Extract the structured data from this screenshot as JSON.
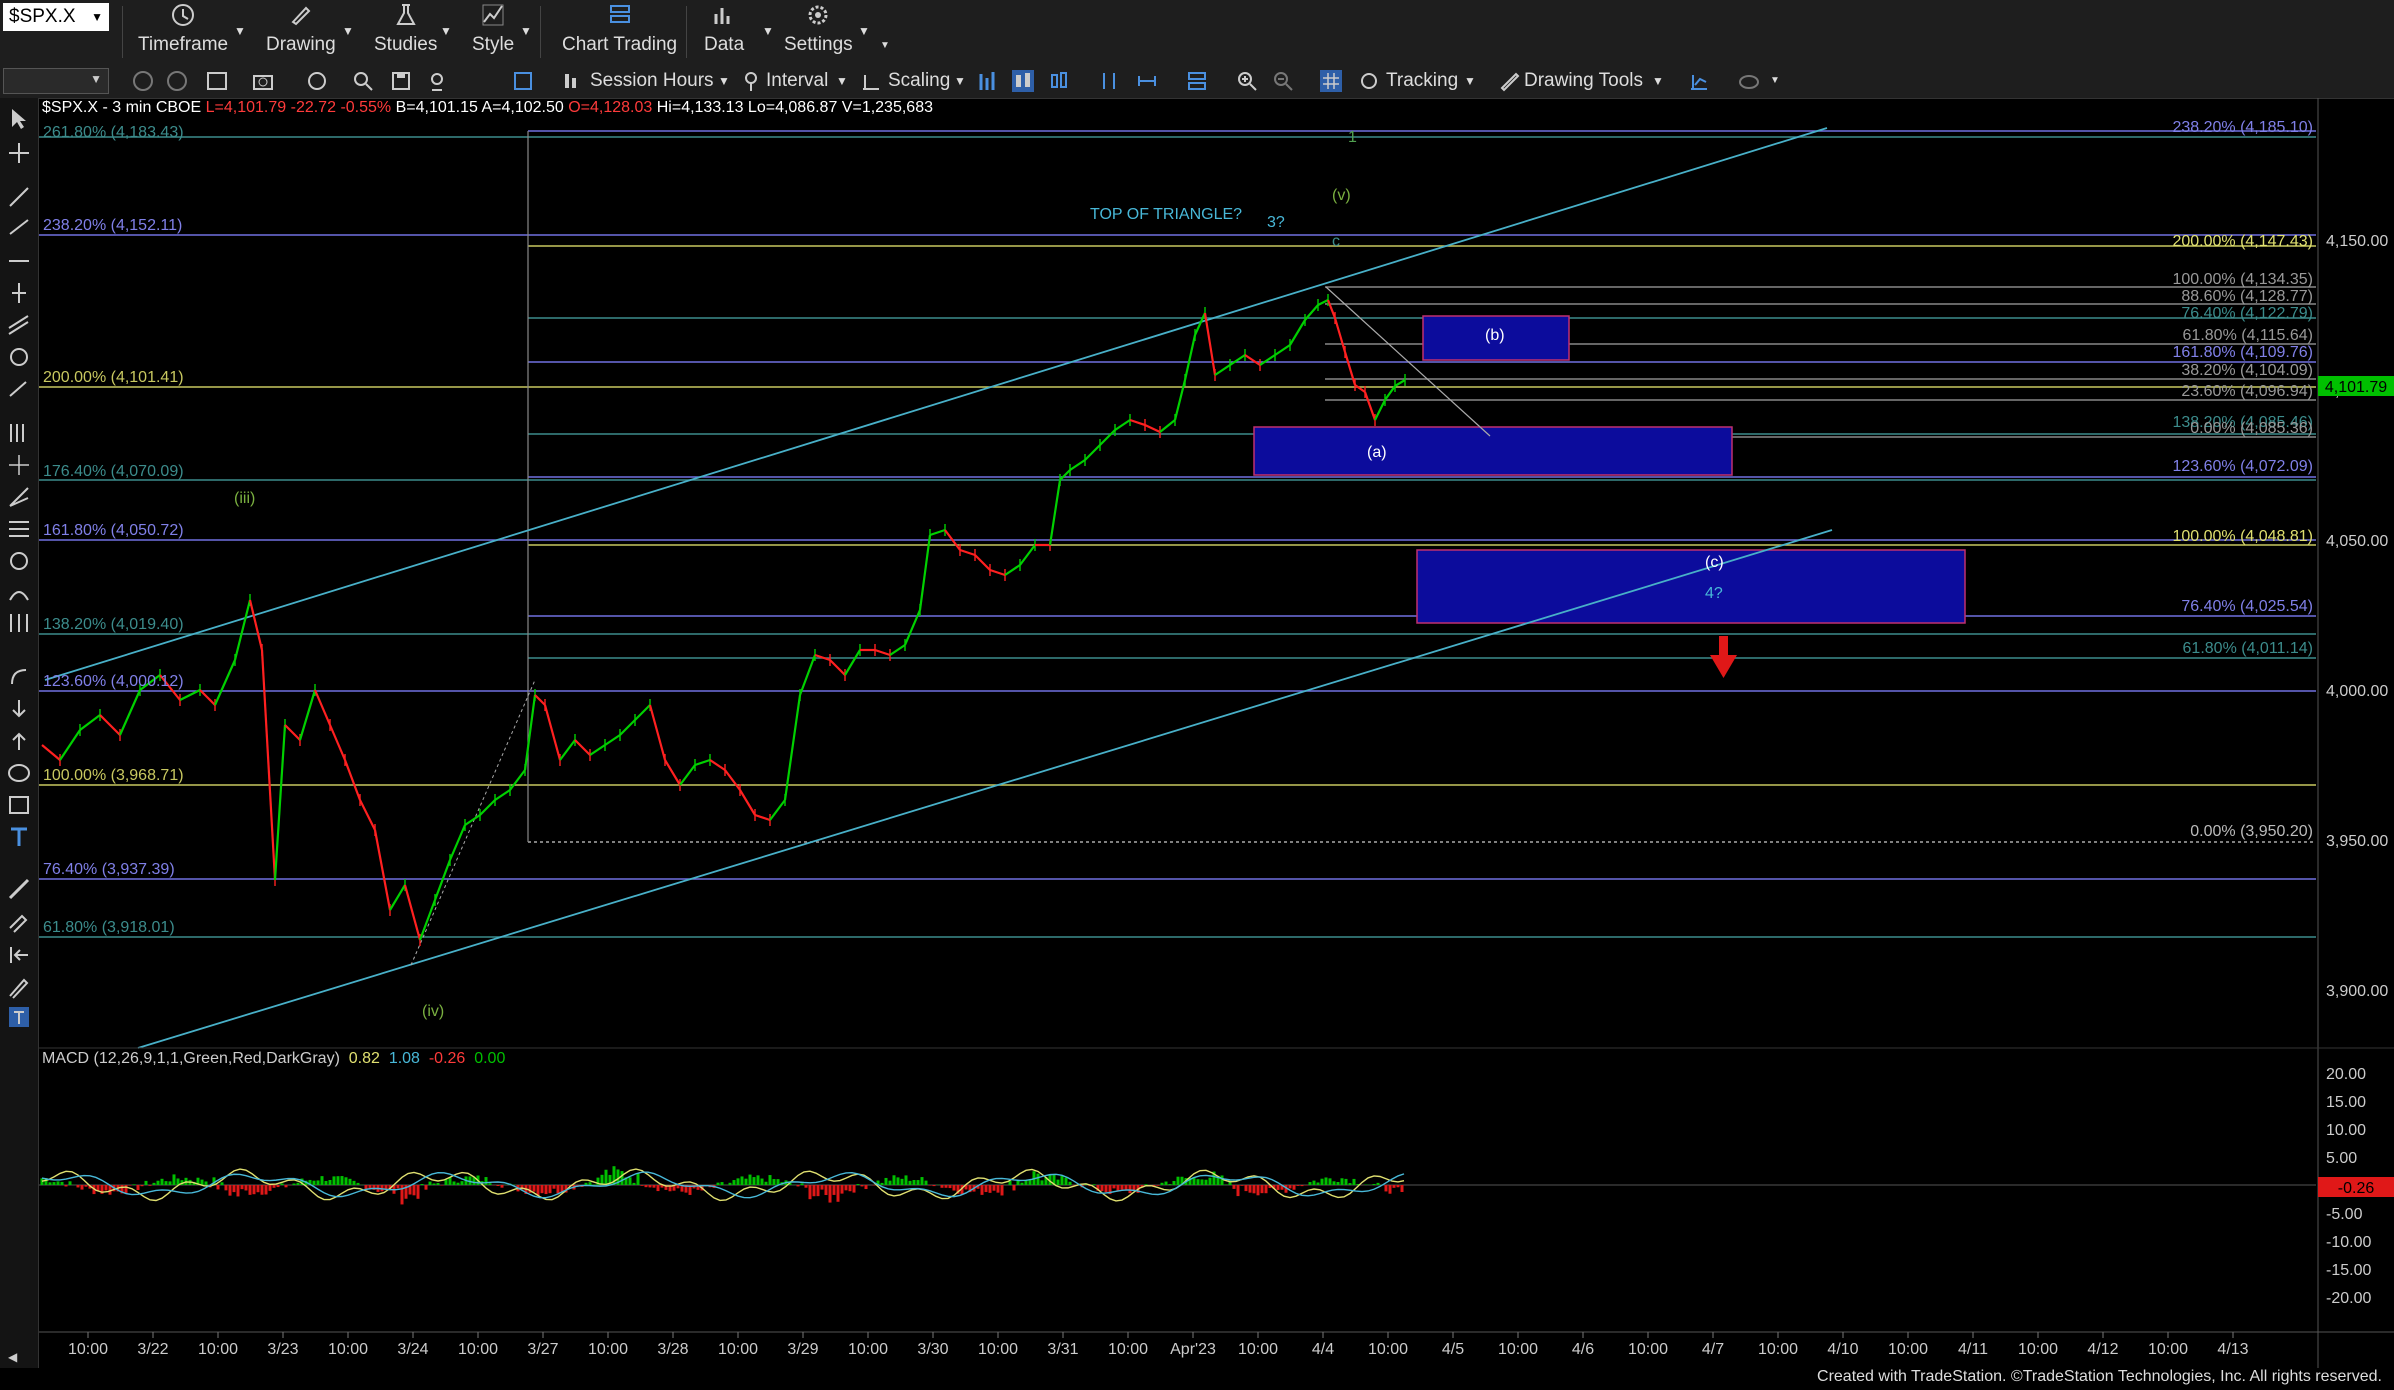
{
  "toolbar": {
    "symbol": "$SPX.X",
    "buttons": [
      "Timeframe",
      "Drawing",
      "Studies",
      "Style",
      "Chart Trading",
      "Data",
      "Settings"
    ],
    "row2": {
      "session_hours": "Session Hours",
      "interval": "Interval",
      "scaling": "Scaling",
      "tracking": "Tracking",
      "drawing_tools": "Drawing Tools"
    }
  },
  "header": {
    "symbol_info": "$SPX.X - 3 min  CBOE",
    "last": "L=4,101.79",
    "change": "-22.72",
    "change_pct": "-0.55%",
    "bid": "B=4,101.15",
    "ask": "A=4,102.50",
    "open": "O=4,128.03",
    "hi": "Hi=4,133.13",
    "lo": "Lo=4,086.87",
    "vol": "V=1,235,683"
  },
  "macd_header": {
    "label": "MACD (12,26,9,1,1,Green,Red,DarkGray)",
    "v1": "0.82",
    "v2": "1.08",
    "v3": "-0.26",
    "v4": "0.00"
  },
  "price_axis": {
    "ticks": [
      "4,150.00",
      "4,100.00",
      "4,050.00",
      "4,000.00",
      "3,950.00",
      "3,900.00"
    ],
    "last_tag": "4,101.79"
  },
  "macd_axis": {
    "ticks": [
      "20.00",
      "15.00",
      "10.00",
      "5.00",
      "-5.00",
      "-10.00",
      "-15.00",
      "-20.00"
    ],
    "last_tag": "-0.26"
  },
  "time_axis": {
    "labels": [
      "10:00",
      "3/22",
      "10:00",
      "3/23",
      "10:00",
      "3/24",
      "10:00",
      "3/27",
      "10:00",
      "3/28",
      "10:00",
      "3/29",
      "10:00",
      "3/30",
      "10:00",
      "3/31",
      "10:00",
      "Apr'23",
      "10:00",
      "4/4",
      "10:00",
      "4/5",
      "10:00",
      "4/6",
      "10:00",
      "4/7",
      "10:00",
      "4/10",
      "10:00",
      "4/11",
      "10:00",
      "4/12",
      "10:00",
      "4/13"
    ]
  },
  "fib_left": [
    "261.80% (4,183.43)",
    "238.20% (4,152.11)",
    "200.00% (4,101.41)",
    "176.40% (4,070.09)",
    "161.80% (4,050.72)",
    "138.20% (4,019.40)",
    "123.60% (4,000.12)",
    "100.00% (3,968.71)",
    "76.40% (3,937.39)",
    "61.80% (3,918.01)"
  ],
  "fib_right": [
    "238.20% (4,185.10)",
    "200.00% (4,147.43)",
    "100.00% (4,134.35)",
    "88.60% (4,128.77)",
    "76.40% (4,122.79)",
    "61.80% (4,115.64)",
    "161.80% (4,109.76)",
    "38.20% (4,104.09)",
    "23.60% (4,096.94)",
    "138.20% (4,085.46)",
    "0.00% (4,085.36)",
    "123.60% (4,072.09)",
    "100.00% (4,048.81)",
    "76.40% (4,025.54)",
    "61.80% (4,011.14)",
    "0.00% (3,950.20)"
  ],
  "annotations": {
    "top_of_triangle": "TOP OF TRIANGLE?",
    "three": "3?",
    "one": "1",
    "v": "(v)",
    "c_small": "c",
    "b": "(b)",
    "a": "(a)",
    "c": "(c)",
    "four": "4?",
    "iii": "(iii)",
    "iv": "(iv)"
  },
  "colors": {
    "background": "#000000",
    "toolbar": "#1e1e1e",
    "price_up": "#00d000",
    "price_down": "#ff2020",
    "fib_yellow": "#c8c860",
    "fib_purple": "#7070e0",
    "fib_teal": "#3c8c8c",
    "box_blue": "#0c0c9c",
    "trendline": "#48b0c8",
    "last_tag": "#00c000",
    "macd_tag": "#ff2020"
  },
  "footer": "Created with TradeStation. ©TradeStation Technologies, Inc. All rights reserved."
}
